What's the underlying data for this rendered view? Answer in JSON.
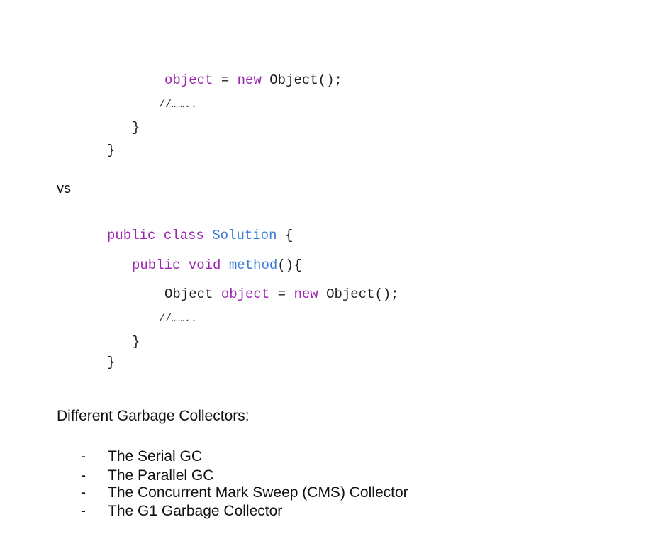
{
  "snippet_a": {
    "line1": {
      "identifier": "object",
      "op": " = ",
      "kw_new": "new",
      "rest": " Object();"
    },
    "comment": "//……..",
    "inner_brace": "}",
    "outer_brace": "}"
  },
  "separator": "vs",
  "snippet_b": {
    "line1": {
      "kw_public": "public",
      "kw_class": "class",
      "class_name": "Solution",
      "brace": " {"
    },
    "line2": {
      "kw_public": "public",
      "kw_void": "void",
      "method_name": "method",
      "rest": "(){"
    },
    "line3": {
      "type": "Object",
      "identifier": "object",
      "op": " = ",
      "kw_new": "new",
      "rest": " Object();"
    },
    "comment": "//……..",
    "inner_brace": "}",
    "outer_brace": "}"
  },
  "gc_heading": "Different Garbage Collectors:",
  "gc_list": {
    "dash": "-",
    "items": [
      "The Serial GC",
      "The Parallel GC",
      "The Concurrent Mark Sweep (CMS) Collector",
      "The G1 Garbage Collector"
    ]
  },
  "colors": {
    "keyword": "#9c27b0",
    "class_name": "#3a7bd5",
    "text": "#1f1f1f"
  }
}
